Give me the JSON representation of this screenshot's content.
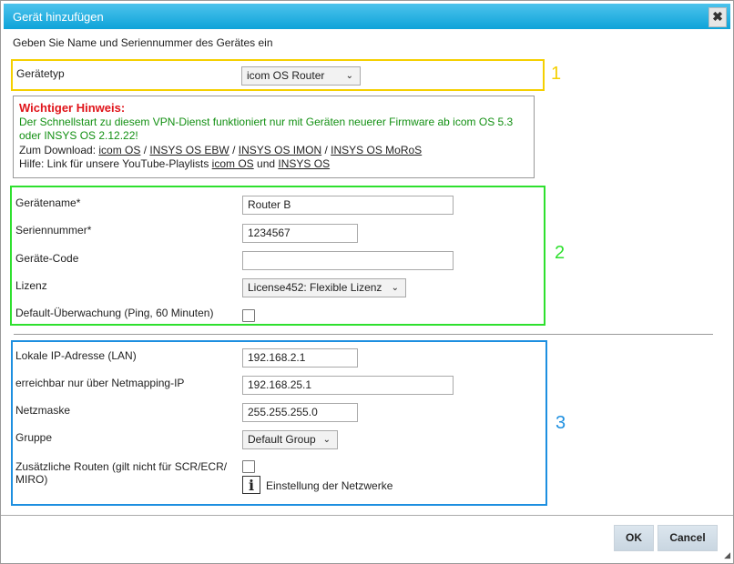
{
  "dialog": {
    "title": "Gerät hinzufügen",
    "close_icon": "close-icon",
    "close_glyph": "✖",
    "intro": "Geben Sie Name und Seriennummer des Gerätes ein"
  },
  "section1": {
    "number": "1",
    "color": "#f5d000",
    "device_type_label": "Gerätetyp",
    "device_type_value": "icom OS Router"
  },
  "notice": {
    "heading": "Wichtiger Hinweis:",
    "message": "Der Schnellstart zu diesem VPN-Dienst funktioniert nur mit Geräten neuerer Firmware ab icom OS 5.3 oder INSYS OS 2.12.22!",
    "download_prefix": "Zum Download: ",
    "download_links": [
      "icom OS",
      "INSYS OS EBW",
      "INSYS OS IMON",
      "INSYS OS MoRoS"
    ],
    "separator": " / ",
    "help_prefix": "Hilfe: Link für unsere YouTube-Playlists ",
    "help_links": [
      "icom OS",
      "INSYS OS"
    ],
    "help_joiner": " und "
  },
  "section2": {
    "number": "2",
    "color": "#2ee02e",
    "device_name_label": "Gerätename*",
    "device_name_value": "Router B",
    "serial_label": "Seriennummer*",
    "serial_value": "1234567",
    "device_code_label": "Geräte-Code",
    "device_code_value": "",
    "license_label": "Lizenz",
    "license_value": "License452: Flexible Lizenz",
    "monitoring_label": "Default-Überwachung (Ping, 60 Minuten)",
    "monitoring_checked": false
  },
  "section3": {
    "number": "3",
    "color": "#1d8fe0",
    "local_ip_label": "Lokale IP-Adresse (LAN)",
    "local_ip_value": "192.168.2.1",
    "netmapping_label": "erreichbar nur über Netmapping-IP",
    "netmapping_value": "192.168.25.1",
    "netmask_label": "Netzmaske",
    "netmask_value": "255.255.255.0",
    "group_label": "Gruppe",
    "group_value": "Default Group",
    "routes_label": "Zusätzliche Routen (gilt nicht für SCR/ECR/ MIRO)",
    "routes_checked": false,
    "network_settings_label": "Einstellung der Netzwerke",
    "info_icon": "info-icon"
  },
  "footer": {
    "ok_label": "OK",
    "cancel_label": "Cancel"
  }
}
